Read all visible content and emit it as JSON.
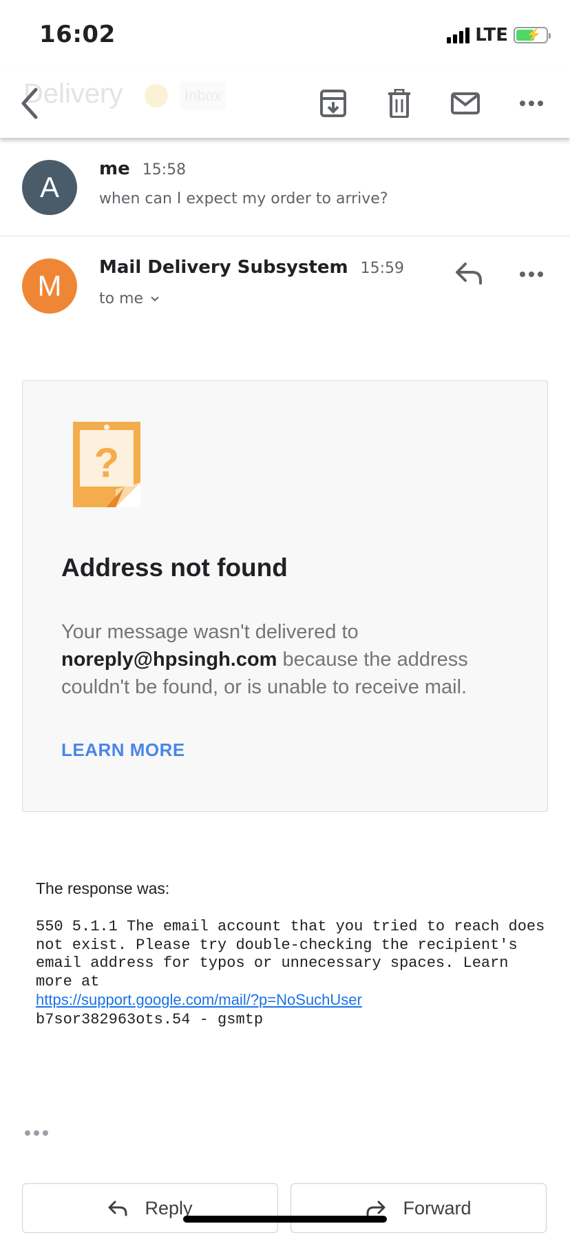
{
  "status_bar": {
    "time": "16:02",
    "network": "LTE"
  },
  "toolbar": {
    "subject_ghost": "Delivery",
    "label_ghost": "Inbox",
    "icons": [
      "back-icon",
      "archive-icon",
      "trash-icon",
      "mail-icon",
      "more-icon"
    ]
  },
  "messages": [
    {
      "avatar_letter": "A",
      "avatar_color": "#4a5b6a",
      "sender": "me",
      "time": "15:58",
      "snippet": "when can I expect my order to arrive?"
    },
    {
      "avatar_letter": "M",
      "avatar_color": "#ef8636",
      "sender": "Mail Delivery Subsystem",
      "time": "15:59",
      "to": "to me"
    }
  ],
  "bounce": {
    "title": "Address not found",
    "body_prefix": "Your message wasn't delivered to",
    "address": "noreply@hpsingh.com",
    "body_suffix": "because the address couldn't be found, or is unable to receive mail.",
    "learn_more": "LEARN MORE"
  },
  "response": {
    "label": "The response was:",
    "text": "550 5.1.1 The email account that you tried to reach does not exist. Please try double-checking the recipient's email address for typos or unnecessary spaces. Learn more at",
    "link": "https://support.google.com/mail/?p=NoSuchUser",
    "trailer": "b7sor382963ots.54 - gsmtp"
  },
  "actions": {
    "reply": "Reply",
    "forward": "Forward"
  },
  "colors": {
    "accent_link": "#4a86e8",
    "icon_orange": "#f4ad4c"
  }
}
